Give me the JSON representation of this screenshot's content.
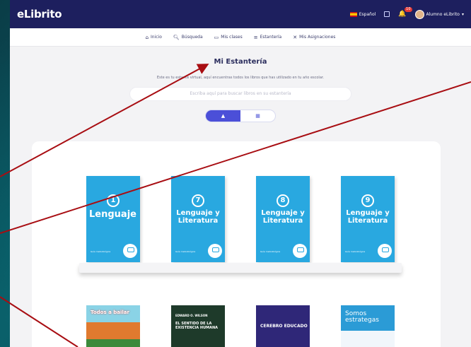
{
  "app": {
    "logo": "eLibrito",
    "language": "Español",
    "notification_count": "10",
    "user_name": "Alumno eLibrito"
  },
  "nav": [
    {
      "label": "Inicio",
      "icon": "home-icon"
    },
    {
      "label": "Búsqueda",
      "icon": "search-icon"
    },
    {
      "label": "Mis clases",
      "icon": "classes-icon"
    },
    {
      "label": "Estantería",
      "icon": "bookshelf-icon"
    },
    {
      "label": "Mis Asignaciones",
      "icon": "assignments-icon"
    }
  ],
  "page": {
    "title": "Mi Estantería",
    "subtitle": "Este es tu estante virtual, aquí encuentras todos los libros que has utilizado en tu año escolar.",
    "search_placeholder": "Escriba aquí para buscar libros en su estantería"
  },
  "view_toggle": [
    "bookshelf-view-icon",
    "grid-view-icon"
  ],
  "books_row1": [
    {
      "number": "1",
      "title": "Lenguaje",
      "series": "Guía metodológica",
      "color": "#29a8e0"
    },
    {
      "number": "7",
      "title": "Lenguaje y Literatura",
      "series": "Guía metodológica",
      "color": "#29a8e0"
    },
    {
      "number": "8",
      "title": "Lenguaje y Literatura",
      "series": "Guía metodológica",
      "color": "#29a8e0"
    },
    {
      "number": "9",
      "title": "Lenguaje y Literatura",
      "series": "Guía metodológica",
      "color": "#29a8e0"
    }
  ],
  "books_row2": [
    {
      "title": "Todos a bailar"
    },
    {
      "author": "EDWARD O. WILSON",
      "title": "EL SENTIDO DE LA EXISTENCIA HUMANA"
    },
    {
      "title": "CEREBRO EDUCADO"
    },
    {
      "title": "Somos estrategas"
    }
  ]
}
